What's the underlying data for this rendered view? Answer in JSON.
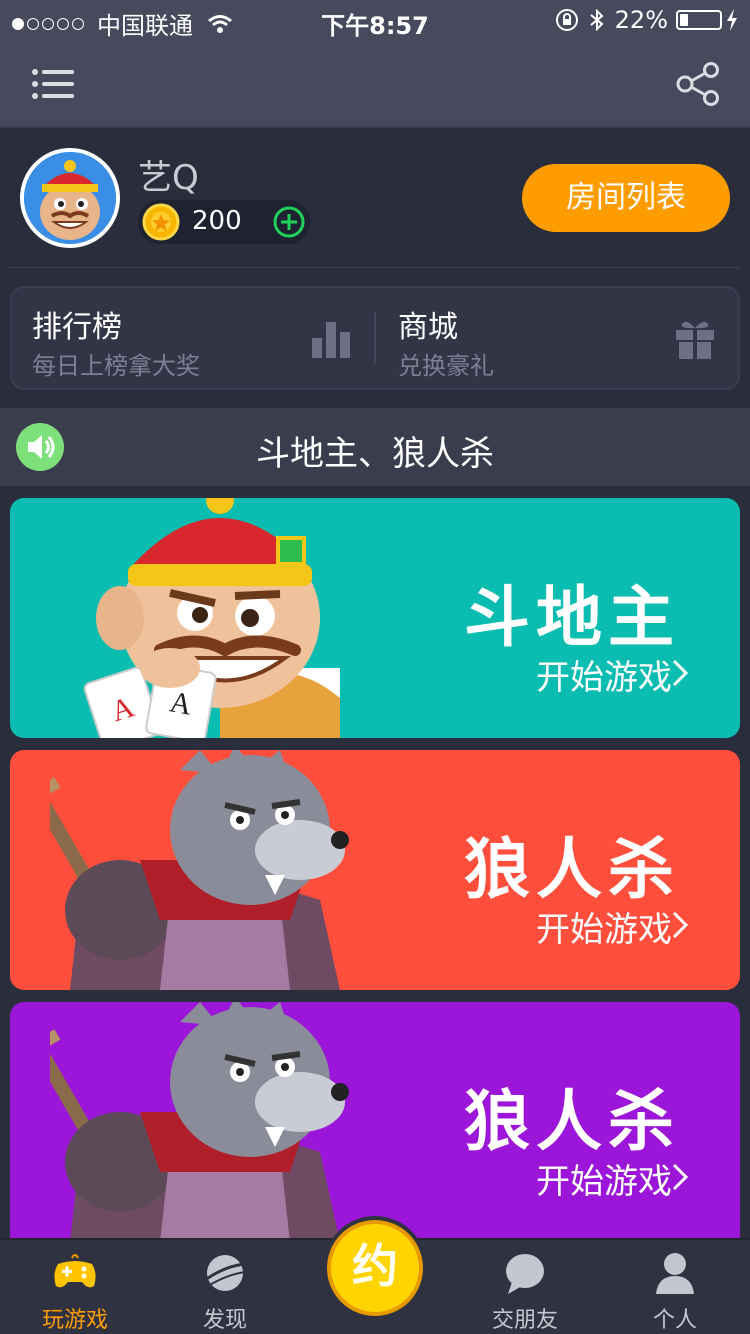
{
  "status_bar": {
    "carrier": "中国联通",
    "time": "下午8:57",
    "battery_text": "22%",
    "battery_level": 0.22,
    "signal_bars": 1
  },
  "nav": {
    "menu_icon": "hamburger-menu-icon",
    "share_icon": "share-icon"
  },
  "profile": {
    "username": "艺Q",
    "coins": "200",
    "room_list_label": "房间列表"
  },
  "quick_links": [
    {
      "title": "排行榜",
      "subtitle": "每日上榜拿大奖",
      "icon": "bar-chart-icon"
    },
    {
      "title": "商城",
      "subtitle": "兑换豪礼",
      "icon": "gift-icon"
    }
  ],
  "notice": {
    "text": "斗地主、狼人杀"
  },
  "games": [
    {
      "name": "斗地主",
      "action": "开始游戏",
      "color": "#0bbdb0"
    },
    {
      "name": "狼人杀",
      "action": "开始游戏",
      "color": "#ff4f3c"
    },
    {
      "name": "狼人杀",
      "action": "开始游戏",
      "color": "#9b16d8"
    }
  ],
  "tabbar": {
    "tabs": [
      {
        "label": "玩游戏",
        "icon": "gamepad-icon",
        "active": true
      },
      {
        "label": "发现",
        "icon": "planet-icon",
        "active": false
      },
      {
        "label": "交朋友",
        "icon": "chat-bubble-icon",
        "active": false
      },
      {
        "label": "个人",
        "icon": "person-icon",
        "active": false
      }
    ],
    "center_label": "约"
  },
  "colors": {
    "accent": "#ff9d00",
    "active_tab": "#ff9d00",
    "background": "#2a2d3b",
    "header": "#474a5c"
  }
}
